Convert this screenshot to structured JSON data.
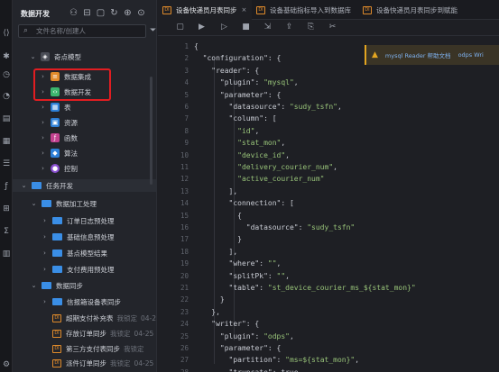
{
  "sidebar": {
    "title": "数据开发",
    "search_placeholder": "文件名称/创建人",
    "tree": [
      {
        "label": "奇点模型"
      },
      {
        "label": "数据集成"
      },
      {
        "label": "数据开发"
      },
      {
        "label": "表"
      },
      {
        "label": "资源"
      },
      {
        "label": "函数"
      },
      {
        "label": "算法"
      },
      {
        "label": "控制"
      },
      {
        "label": "任务开发"
      },
      {
        "label": "数据加工处理"
      },
      {
        "label": "订单日志预处理"
      },
      {
        "label": "基础信息预处理"
      },
      {
        "label": "基点模型结果"
      },
      {
        "label": "支付费用预处理"
      },
      {
        "label": "数据同步"
      },
      {
        "label": "信报箱设备表同步"
      },
      {
        "label": "超期支付补充表",
        "note": "我锁定",
        "time": "04-2"
      },
      {
        "label": "存放订单同步",
        "note": "我锁定",
        "time": "04-25"
      },
      {
        "label": "第三方支付表同步",
        "note": "我锁定"
      },
      {
        "label": "派件订单同步",
        "note": "我锁定",
        "time": "04-25"
      }
    ]
  },
  "tabs": [
    {
      "label": "设备快递员月表同步",
      "badge": "DI",
      "active": true
    },
    {
      "label": "设备基础指标导入到数据库",
      "badge": "DI"
    },
    {
      "label": "设备快递员月表同步到赋能",
      "badge": "DI"
    }
  ],
  "warning": {
    "link1": "mysql Reader 帮助文档",
    "link2": "odps Wri"
  },
  "line_numbers": [
    "1",
    "2",
    "3",
    "4",
    "5",
    "6",
    "7",
    "8",
    "9",
    "10",
    "11",
    "12",
    "13",
    "14",
    "15",
    "16",
    "17",
    "18",
    "19",
    "20",
    "21",
    "22",
    "23",
    "24",
    "25",
    "26",
    "27",
    "28"
  ],
  "code": [
    "{",
    "  \"configuration\": {",
    "    \"reader\": {",
    "      \"plugin\": \"mysql\",",
    "      \"parameter\": {",
    "        \"datasource\": \"sudy_tsfn\",",
    "        \"column\": [",
    "          \"id\",",
    "          \"stat_mon\",",
    "          \"device_id\",",
    "          \"delivery_courier_num\",",
    "          \"active_courier_num\"",
    "        ],",
    "        \"connection\": [",
    "          {",
    "            \"datasource\": \"sudy_tsfn\"",
    "          }",
    "        ],",
    "        \"where\": \"\",",
    "        \"splitPk\": \"\",",
    "        \"table\": \"st_device_courier_ms_${stat_mon}\"",
    "      }",
    "    },",
    "    \"writer\": {",
    "      \"plugin\": \"odps\",",
    "      \"parameter\": {",
    "        \"partition\": \"ms=${stat_mon}\",",
    "        \"truncate\": true,"
  ],
  "colors": {
    "accent": "#3a8ee6",
    "highlight": "#e11d21",
    "warning": "#e3a521",
    "string": "#98c379"
  }
}
